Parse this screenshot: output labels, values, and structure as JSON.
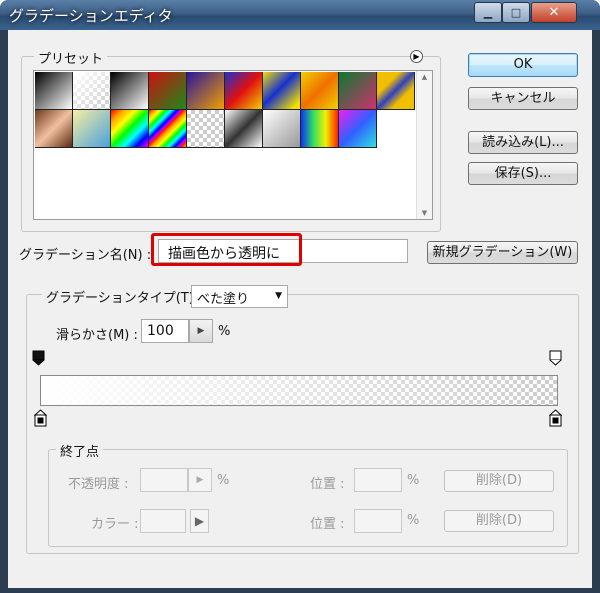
{
  "window": {
    "title": "グラデーションエディタ",
    "controls": {
      "minimize": "▁",
      "maximize": "□",
      "close": "✕"
    }
  },
  "preset": {
    "label": "プリセット",
    "menu_icon": "circle-right-arrow-icon",
    "swatches": [
      "linear-gradient(135deg,#000,#fff)",
      "checker-fade",
      "linear-gradient(135deg,#000,#fff)",
      "linear-gradient(135deg,#d01010,#1a8a1a)",
      "linear-gradient(135deg,#2a14a0,#f0a000)",
      "linear-gradient(135deg,#1b2fd0,#e01010,#f2d000)",
      "linear-gradient(135deg,#f2e000 0%,#1830d0 45%,#f2e000 90%)",
      "linear-gradient(135deg,#f0d000,#f07000,#f0d000)",
      "linear-gradient(135deg,#0a7a30,#d03070)",
      "linear-gradient(135deg,#f0c000 30%,#3040c0 50%,#f0c000 70%)",
      "linear-gradient(135deg,#6b3a1a,#f2c0a0,#5a2a10)",
      "linear-gradient(135deg,#f7f0a0,#4aa0e0)",
      "linear-gradient(135deg,red,orange,yellow,lime,cyan,blue,magenta)",
      "repeating-linear-gradient(135deg,red 0,orange 4px,yellow 8px,lime 12px,cyan 16px,blue 20px,magenta 24px)",
      "checker",
      "linear-gradient(135deg,#fff 0%,#333 50%,#fff 100%)",
      "linear-gradient(135deg,#fff,#999)",
      "linear-gradient(90deg,#1030ff,#30e060,#f0f000,#ff2000)",
      "linear-gradient(135deg,#f020f0,#3060ff,#30e0e0)"
    ],
    "scroll_up": "▲",
    "scroll_down": "▼"
  },
  "buttons": {
    "ok": "OK",
    "cancel": "キャンセル",
    "load": "読み込み(L)...",
    "save": "保存(S)...",
    "new_gradient": "新規グラデーション(W)"
  },
  "name": {
    "label": "グラデーション名(N) :",
    "value": "描画色から透明に",
    "highlight_color": "#e00000"
  },
  "gradient": {
    "type_label": "グラデーションタイプ(T) :",
    "type_value": "べた塗り",
    "smoothness_label": "滑らかさ(M) :",
    "smoothness_value": "100",
    "smoothness_unit": "%"
  },
  "stops": {
    "legend": "終了点",
    "opacity_label": "不透明度 :",
    "opacity_unit": "%",
    "location_label": "位置 :",
    "location_unit": "%",
    "delete_label": "削除(D)",
    "color_label": "カラー :",
    "color_location_label": "位置 :",
    "color_location_unit": "%",
    "color_delete_label": "削除(D)"
  },
  "colors": {
    "accent_border": "#3c7fb1",
    "titlebar": "#3d5f86"
  }
}
